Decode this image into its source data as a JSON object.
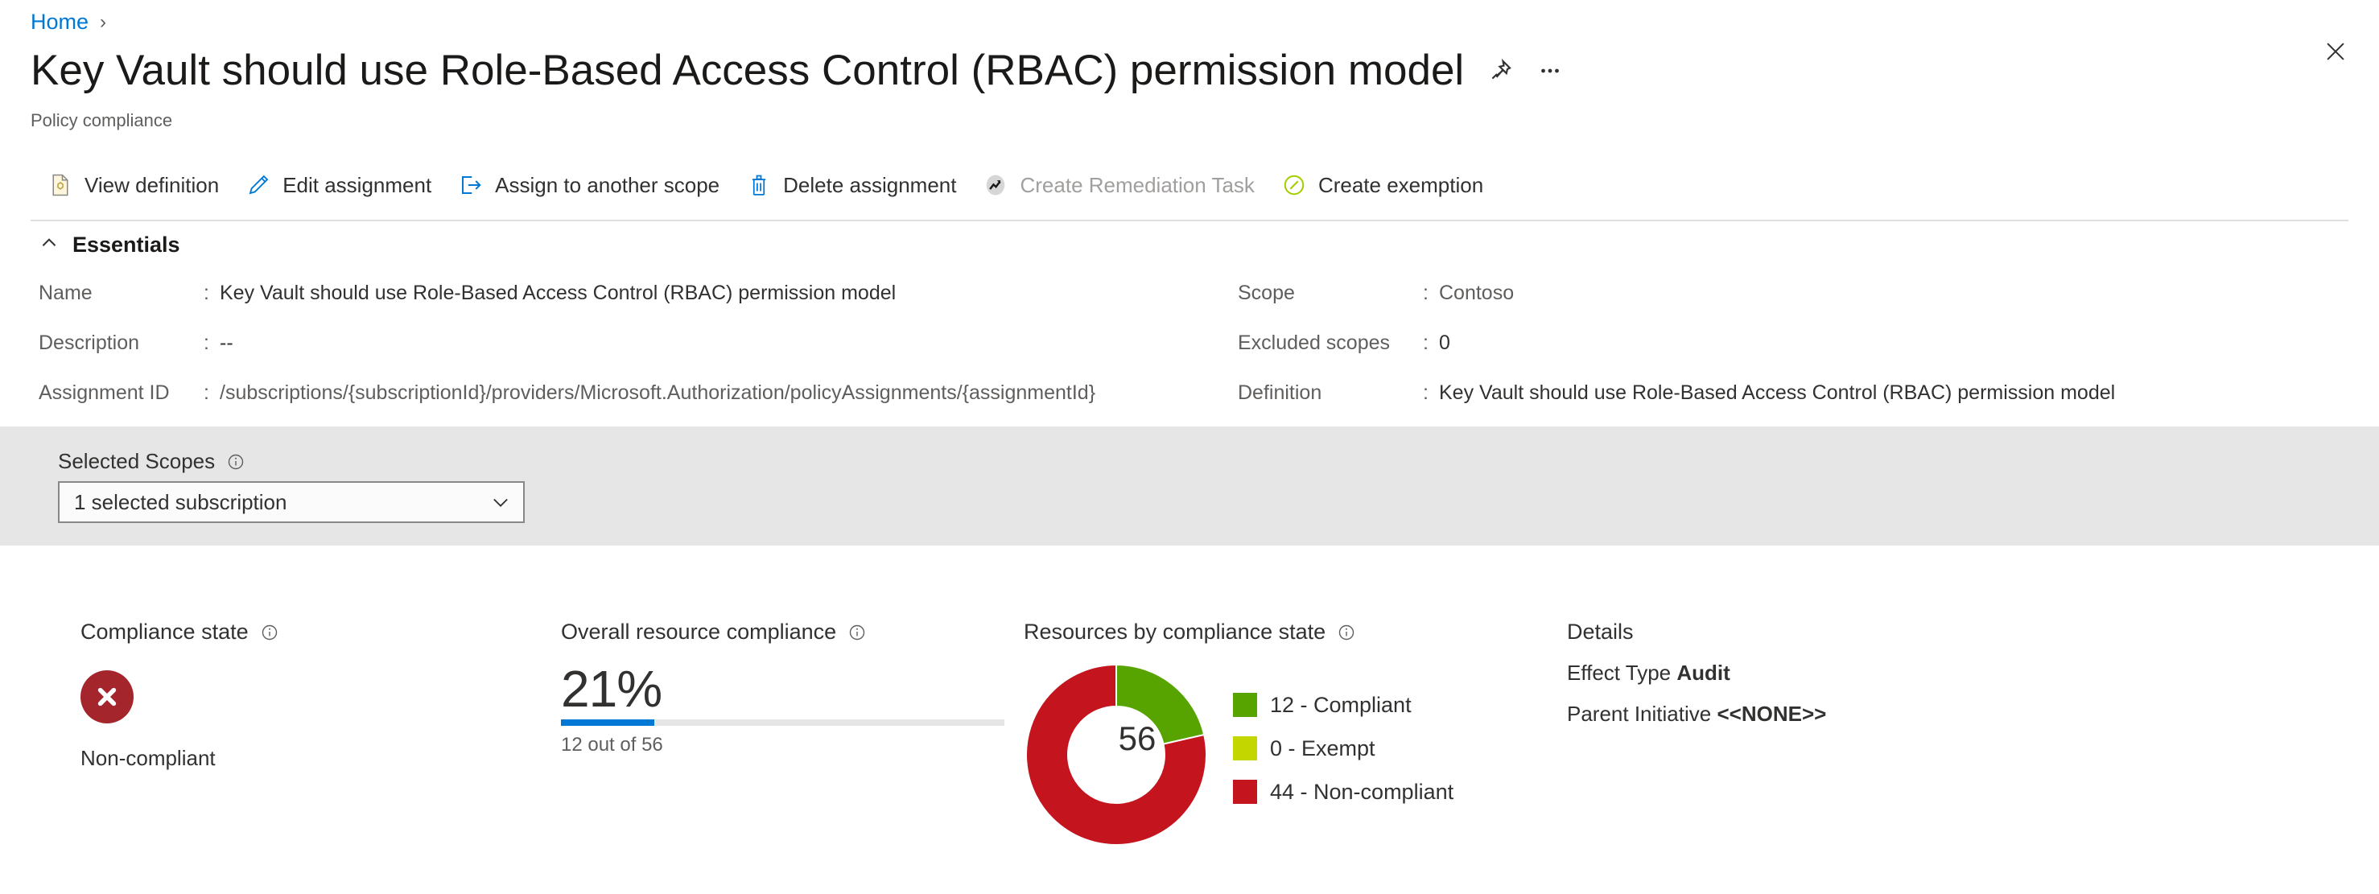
{
  "breadcrumb": {
    "home": "Home",
    "separator": "›"
  },
  "header": {
    "title": "Key Vault should use Role-Based Access Control (RBAC) permission model",
    "subtitle": "Policy compliance"
  },
  "toolbar": {
    "items": [
      {
        "label": "View definition",
        "icon": "document-icon",
        "disabled": false
      },
      {
        "label": "Edit assignment",
        "icon": "pencil-icon",
        "disabled": false
      },
      {
        "label": "Assign to another scope",
        "icon": "export-icon",
        "disabled": false
      },
      {
        "label": "Delete assignment",
        "icon": "trash-icon",
        "disabled": false
      },
      {
        "label": "Create Remediation Task",
        "icon": "trend-icon",
        "disabled": true
      },
      {
        "label": "Create exemption",
        "icon": "exempt-icon",
        "disabled": false
      }
    ]
  },
  "essentials": {
    "section_label": "Essentials",
    "left": [
      {
        "key": "Name",
        "value": "Key Vault should use Role-Based Access Control (RBAC) permission model",
        "muted": false
      },
      {
        "key": "Description",
        "value": "--",
        "muted": false
      },
      {
        "key": "Assignment ID",
        "value": "/subscriptions/{subscriptionId}/providers/Microsoft.Authorization/policyAssignments/{assignmentId}",
        "muted": true
      }
    ],
    "right": [
      {
        "key": "Scope",
        "value": "Contoso",
        "muted": true
      },
      {
        "key": "Excluded scopes",
        "value": "0",
        "muted": false
      },
      {
        "key": "Definition",
        "value": "Key Vault should use Role-Based Access Control (RBAC) permission model",
        "muted": false
      }
    ]
  },
  "selected_scopes": {
    "label": "Selected Scopes",
    "value": "1 selected subscription"
  },
  "metrics": {
    "compliance_state": {
      "title": "Compliance state",
      "status": "Non-compliant",
      "color": "#a4262c"
    },
    "overall": {
      "title": "Overall resource compliance",
      "percent_label": "21%",
      "percent_value": 21,
      "sub": "12 out of 56",
      "bar_color": "#0078d4"
    },
    "donut": {
      "title": "Resources by compliance state",
      "center": "56"
    },
    "details": {
      "title": "Details",
      "effect_type_label": "Effect Type",
      "effect_type_value": "Audit",
      "parent_initiative_label": "Parent Initiative",
      "parent_initiative_value": "<<NONE>>"
    }
  },
  "chart_data": {
    "type": "pie",
    "title": "Resources by compliance state",
    "total": 56,
    "center_label": "56",
    "legend_position": "right",
    "categories": [
      "Compliant",
      "Exempt",
      "Non-compliant"
    ],
    "values": [
      12,
      0,
      44
    ],
    "colors": [
      "#57a300",
      "#c3d600",
      "#c4141e"
    ],
    "legend": [
      "12 - Compliant",
      "0 - Exempt",
      "44 - Non-compliant"
    ]
  }
}
